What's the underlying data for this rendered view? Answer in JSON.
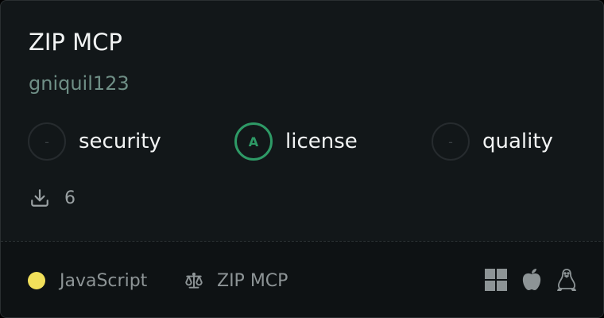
{
  "card": {
    "title": "ZIP MCP",
    "author": "gniquil123",
    "scores": [
      {
        "grade": "-",
        "label": "security"
      },
      {
        "grade": "A",
        "label": "license"
      },
      {
        "grade": "-",
        "label": "quality"
      }
    ],
    "downloads": {
      "icon": "download-icon",
      "count": "6"
    },
    "footer": {
      "language": {
        "name": "JavaScript",
        "color": "#f1e05a"
      },
      "license": {
        "icon": "scale-icon",
        "name": "ZIP MCP"
      },
      "platforms": [
        "windows-icon",
        "apple-icon",
        "linux-icon"
      ]
    }
  },
  "colors": {
    "background": "#121719",
    "footer_background": "#0e1214",
    "grade_a": "#2e9a66",
    "author": "#6f8f86"
  }
}
